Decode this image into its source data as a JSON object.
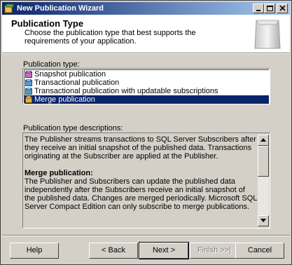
{
  "window": {
    "title": "New Publication Wizard"
  },
  "header": {
    "title": "Publication Type",
    "description": "Choose the publication type that best supports the requirements of your application."
  },
  "publication_type": {
    "label": "Publication type:",
    "items": [
      {
        "label": "Snapshot publication",
        "icon": "snapshot-publication-icon"
      },
      {
        "label": "Transactional publication",
        "icon": "transactional-publication-icon"
      },
      {
        "label": "Transactional publication with updatable subscriptions",
        "icon": "updatable-publication-icon"
      },
      {
        "label": "Merge publication",
        "icon": "merge-publication-icon",
        "selected": true
      }
    ]
  },
  "descriptions": {
    "label": "Publication type descriptions:",
    "intro": "The Publisher streams transactions to SQL Server Subscribers after they receive an initial snapshot of the published data. Transactions originating at the Subscriber are applied at the Publisher.",
    "merge_heading": "Merge publication:",
    "merge_body": "The Publisher and Subscribers can update the published data independently after the Subscribers receive an initial snapshot of the published data. Changes are merged periodically. Microsoft SQL Server Compact Edition can only subscribe to merge publications."
  },
  "buttons": {
    "help": "Help",
    "back": "< Back",
    "next": "Next >",
    "finish": "Finish >>|",
    "cancel": "Cancel"
  },
  "colors": {
    "selection": "#0a246a",
    "titlebar_start": "#0a246a",
    "titlebar_end": "#a6caf0",
    "face": "#d4d0c8"
  }
}
